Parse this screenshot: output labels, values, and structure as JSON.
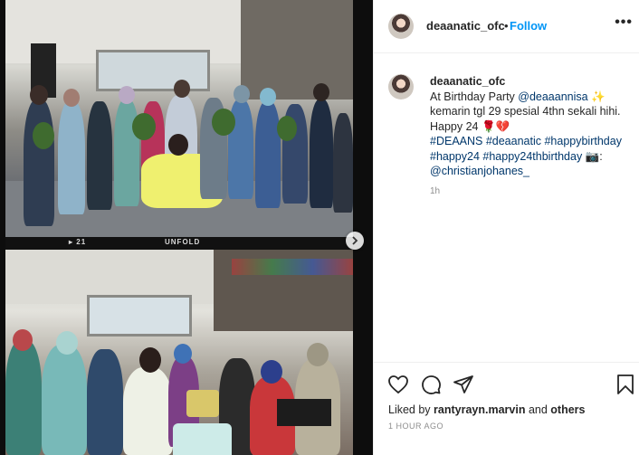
{
  "author": {
    "username": "deaanatic_ofc",
    "follow_label": "Follow",
    "separator": "•"
  },
  "media": {
    "film_left": "▸ 21",
    "film_right": "UNFOLD"
  },
  "caption": {
    "username": "deaanatic_ofc",
    "line1_prefix": "At Birthday Party ",
    "mention1": "@deaaannisa",
    "line1_suffix": " ✨",
    "line2": "kemarin tgl 29 spesial 4thn sekali hihi.",
    "line3": "Happy 24 🌹💔",
    "tags1": "#DEAANS #deaanatic #happybirthday",
    "tags2": "#happy24 #happy24thbirthday",
    "camera": " 📷:",
    "mention2": "@christianjohanes_",
    "time": "1h"
  },
  "footer": {
    "liked_prefix": "Liked by ",
    "liked_user": "rantyrayn.marvin",
    "liked_middle": " and ",
    "liked_others": "others",
    "time": "1 HOUR AGO"
  },
  "colors": {
    "accent": "#0095f6",
    "link": "#00376b",
    "muted": "#8e8e8e"
  },
  "icons": [
    "heart-icon",
    "comment-icon",
    "share-icon",
    "bookmark-icon",
    "chevron-right-icon",
    "more-icon"
  ]
}
